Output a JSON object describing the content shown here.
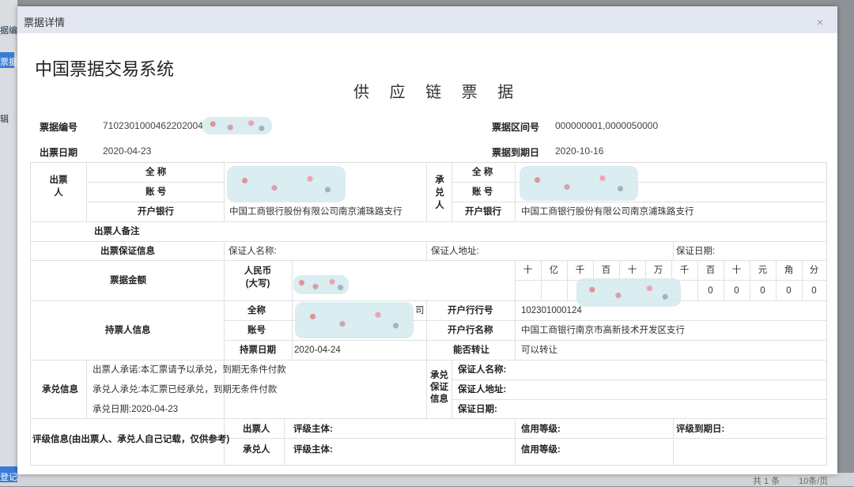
{
  "background": {
    "left_texts": [
      "据编",
      "票据",
      "辑",
      "登记"
    ],
    "pager": [
      "共 1 条",
      "10条/页"
    ]
  },
  "modal": {
    "title": "票据详情",
    "close": "×"
  },
  "system_title": "中国票据交易系统",
  "bill_type": "供 应 链 票 据",
  "meta": {
    "bill_no_label": "票据编号",
    "bill_no_value": "7102301000462202004",
    "range_label": "票据区间号",
    "range_value": "000000001,0000050000",
    "issue_date_label": "出票日期",
    "issue_date_value": "2020-04-23",
    "due_date_label": "票据到期日",
    "due_date_value": "2020-10-16"
  },
  "drawer": {
    "title": "出票人",
    "name_label": "全 称",
    "account_label": "账 号",
    "bank_label": "开户银行",
    "bank_value": "中国工商银行股份有限公司南京浦珠路支行"
  },
  "acceptor": {
    "title": "承兑人",
    "name_label": "全 称",
    "account_label": "账 号",
    "bank_label": "开户银行",
    "bank_value": "中国工商银行股份有限公司南京浦珠路支行"
  },
  "remark_label": "出票人备注",
  "guarantee": {
    "label": "出票保证信息",
    "name": "保证人名称:",
    "address": "保证人地址:",
    "date": "保证日期:"
  },
  "amount": {
    "label": "票据金额",
    "rmb": "人民币",
    "rmb2": "(大写)",
    "digits": [
      "十",
      "亿",
      "千",
      "百",
      "十",
      "万",
      "千",
      "百",
      "十",
      "元",
      "角",
      "分"
    ],
    "values": [
      "0",
      "0",
      "0",
      "0",
      "0",
      "0"
    ]
  },
  "holder": {
    "label": "持票人信息",
    "name_label": "全称",
    "account_label": "账号",
    "date_label": "持票日期",
    "date_value": "2020-04-24",
    "name_suffix": "司",
    "bank_no_label": "开户行行号",
    "bank_no_value": "102301000124",
    "bank_name_label": "开户行名称",
    "bank_name_value": "中国工商银行南京市高新技术开发区支行",
    "transfer_label": "能否转让",
    "transfer_value": "可以转让"
  },
  "acceptance": {
    "label": "承兑信息",
    "drawer_promise": "出票人承诺:本汇票请予以承兑，到期无条件付款",
    "acceptor_promise": "承兑人承兑:本汇票已经承兑，到期无条件付款",
    "accept_date": "承兑日期:2020-04-23",
    "guar_title": "承兑保证信息",
    "guar_name": "保证人名称:",
    "guar_address": "保证人地址:",
    "guar_date": "保证日期:"
  },
  "rating": {
    "label": "评级信息(由出票人、承兑人自己记载，仅供参考)",
    "drawer": "出票人",
    "acceptor": "承兑人",
    "subject": "评级主体:",
    "credit": "信用等级:",
    "expiry": "评级到期日:"
  }
}
